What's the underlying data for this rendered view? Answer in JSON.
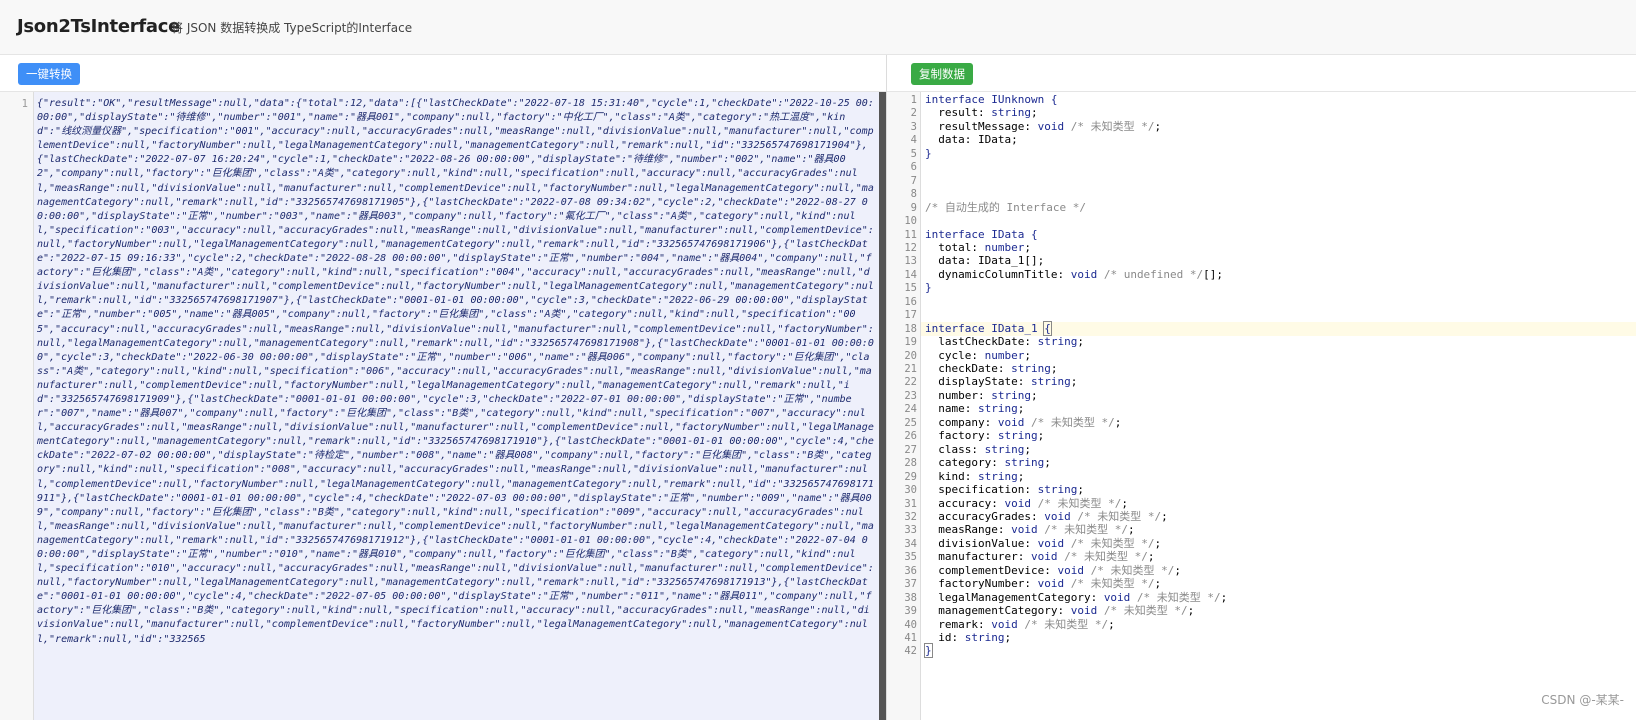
{
  "app": {
    "title": "Json2TsInterface",
    "subtitle": "将 JSON 数据转换成 TypeScript的Interface"
  },
  "toolbar": {
    "convert_label": "一键转换",
    "copy_label": "复制数据"
  },
  "left_editor": {
    "line_number": "1",
    "content": "{\"result\":\"OK\",\"resultMessage\":null,\"data\":{\"total\":12,\"data\":[{\"lastCheckDate\":\"2022-07-18 15:31:40\",\"cycle\":1,\"checkDate\":\"2022-10-25 00:00:00\",\"displayState\":\"待维修\",\"number\":\"001\",\"name\":\"器具001\",\"company\":null,\"factory\":\"中化工厂\",\"class\":\"A类\",\"category\":\"热工温度\",\"kind\":\"线纹测量仪器\",\"specification\":\"001\",\"accuracy\":null,\"accuracyGrades\":null,\"measRange\":null,\"divisionValue\":null,\"manufacturer\":null,\"complementDevice\":null,\"factoryNumber\":null,\"legalManagementCategory\":null,\"managementCategory\":null,\"remark\":null,\"id\":\"332565747698171904\"},{\"lastCheckDate\":\"2022-07-07 16:20:24\",\"cycle\":1,\"checkDate\":\"2022-08-26 00:00:00\",\"displayState\":\"待维修\",\"number\":\"002\",\"name\":\"器具002\",\"company\":null,\"factory\":\"巨化集团\",\"class\":\"A类\",\"category\":null,\"kind\":null,\"specification\":null,\"accuracy\":null,\"accuracyGrades\":null,\"measRange\":null,\"divisionValue\":null,\"manufacturer\":null,\"complementDevice\":null,\"factoryNumber\":null,\"legalManagementCategory\":null,\"managementCategory\":null,\"remark\":null,\"id\":\"332565747698171905\"},{\"lastCheckDate\":\"2022-07-08 09:34:02\",\"cycle\":2,\"checkDate\":\"2022-08-27 00:00:00\",\"displayState\":\"正常\",\"number\":\"003\",\"name\":\"器具003\",\"company\":null,\"factory\":\"氟化工厂\",\"class\":\"A类\",\"category\":null,\"kind\":null,\"specification\":\"003\",\"accuracy\":null,\"accuracyGrades\":null,\"measRange\":null,\"divisionValue\":null,\"manufacturer\":null,\"complementDevice\":null,\"factoryNumber\":null,\"legalManagementCategory\":null,\"managementCategory\":null,\"remark\":null,\"id\":\"332565747698171906\"},{\"lastCheckDate\":\"2022-07-15 09:16:33\",\"cycle\":2,\"checkDate\":\"2022-08-28 00:00:00\",\"displayState\":\"正常\",\"number\":\"004\",\"name\":\"器具004\",\"company\":null,\"factory\":\"巨化集团\",\"class\":\"A类\",\"category\":null,\"kind\":null,\"specification\":\"004\",\"accuracy\":null,\"accuracyGrades\":null,\"measRange\":null,\"divisionValue\":null,\"manufacturer\":null,\"complementDevice\":null,\"factoryNumber\":null,\"legalManagementCategory\":null,\"managementCategory\":null,\"remark\":null,\"id\":\"332565747698171907\"},{\"lastCheckDate\":\"0001-01-01 00:00:00\",\"cycle\":3,\"checkDate\":\"2022-06-29 00:00:00\",\"displayState\":\"正常\",\"number\":\"005\",\"name\":\"器具005\",\"company\":null,\"factory\":\"巨化集团\",\"class\":\"A类\",\"category\":null,\"kind\":null,\"specification\":\"005\",\"accuracy\":null,\"accuracyGrades\":null,\"measRange\":null,\"divisionValue\":null,\"manufacturer\":null,\"complementDevice\":null,\"factoryNumber\":null,\"legalManagementCategory\":null,\"managementCategory\":null,\"remark\":null,\"id\":\"332565747698171908\"},{\"lastCheckDate\":\"0001-01-01 00:00:00\",\"cycle\":3,\"checkDate\":\"2022-06-30 00:00:00\",\"displayState\":\"正常\",\"number\":\"006\",\"name\":\"器具006\",\"company\":null,\"factory\":\"巨化集团\",\"class\":\"A类\",\"category\":null,\"kind\":null,\"specification\":\"006\",\"accuracy\":null,\"accuracyGrades\":null,\"measRange\":null,\"divisionValue\":null,\"manufacturer\":null,\"complementDevice\":null,\"factoryNumber\":null,\"legalManagementCategory\":null,\"managementCategory\":null,\"remark\":null,\"id\":\"332565747698171909\"},{\"lastCheckDate\":\"0001-01-01 00:00:00\",\"cycle\":3,\"checkDate\":\"2022-07-01 00:00:00\",\"displayState\":\"正常\",\"number\":\"007\",\"name\":\"器具007\",\"company\":null,\"factory\":\"巨化集团\",\"class\":\"B类\",\"category\":null,\"kind\":null,\"specification\":\"007\",\"accuracy\":null,\"accuracyGrades\":null,\"measRange\":null,\"divisionValue\":null,\"manufacturer\":null,\"complementDevice\":null,\"factoryNumber\":null,\"legalManagementCategory\":null,\"managementCategory\":null,\"remark\":null,\"id\":\"332565747698171910\"},{\"lastCheckDate\":\"0001-01-01 00:00:00\",\"cycle\":4,\"checkDate\":\"2022-07-02 00:00:00\",\"displayState\":\"待检定\",\"number\":\"008\",\"name\":\"器具008\",\"company\":null,\"factory\":\"巨化集团\",\"class\":\"B类\",\"category\":null,\"kind\":null,\"specification\":\"008\",\"accuracy\":null,\"accuracyGrades\":null,\"measRange\":null,\"divisionValue\":null,\"manufacturer\":null,\"complementDevice\":null,\"factoryNumber\":null,\"legalManagementCategory\":null,\"managementCategory\":null,\"remark\":null,\"id\":\"332565747698171911\"},{\"lastCheckDate\":\"0001-01-01 00:00:00\",\"cycle\":4,\"checkDate\":\"2022-07-03 00:00:00\",\"displayState\":\"正常\",\"number\":\"009\",\"name\":\"器具009\",\"company\":null,\"factory\":\"巨化集团\",\"class\":\"B类\",\"category\":null,\"kind\":null,\"specification\":\"009\",\"accuracy\":null,\"accuracyGrades\":null,\"measRange\":null,\"divisionValue\":null,\"manufacturer\":null,\"complementDevice\":null,\"factoryNumber\":null,\"legalManagementCategory\":null,\"managementCategory\":null,\"remark\":null,\"id\":\"332565747698171912\"},{\"lastCheckDate\":\"0001-01-01 00:00:00\",\"cycle\":4,\"checkDate\":\"2022-07-04 00:00:00\",\"displayState\":\"正常\",\"number\":\"010\",\"name\":\"器具010\",\"company\":null,\"factory\":\"巨化集团\",\"class\":\"B类\",\"category\":null,\"kind\":null,\"specification\":\"010\",\"accuracy\":null,\"accuracyGrades\":null,\"measRange\":null,\"divisionValue\":null,\"manufacturer\":null,\"complementDevice\":null,\"factoryNumber\":null,\"legalManagementCategory\":null,\"managementCategory\":null,\"remark\":null,\"id\":\"332565747698171913\"},{\"lastCheckDate\":\"0001-01-01 00:00:00\",\"cycle\":4,\"checkDate\":\"2022-07-05 00:00:00\",\"displayState\":\"正常\",\"number\":\"011\",\"name\":\"器具011\",\"company\":null,\"factory\":\"巨化集团\",\"class\":\"B类\",\"category\":null,\"kind\":null,\"specification\":null,\"accuracy\":null,\"accuracyGrades\":null,\"measRange\":null,\"divisionValue\":null,\"manufacturer\":null,\"complementDevice\":null,\"factoryNumber\":null,\"legalManagementCategory\":null,\"managementCategory\":null,\"remark\":null,\"id\":\"332565"
  },
  "right_editor": {
    "lines": [
      {
        "n": "1",
        "parts": [
          [
            "kw",
            "interface IUnknown {"
          ]
        ]
      },
      {
        "n": "2",
        "parts": [
          [
            "t",
            "  result: "
          ],
          [
            "kw",
            "string"
          ],
          [
            "t",
            ";"
          ]
        ]
      },
      {
        "n": "3",
        "parts": [
          [
            "t",
            "  resultMessage: "
          ],
          [
            "kw",
            "void"
          ],
          [
            "cm",
            " /* 未知类型 */"
          ],
          [
            "t",
            ";"
          ]
        ]
      },
      {
        "n": "4",
        "parts": [
          [
            "t",
            "  data: IData;"
          ]
        ]
      },
      {
        "n": "5",
        "parts": [
          [
            "kw",
            "}"
          ]
        ]
      },
      {
        "n": "6",
        "parts": []
      },
      {
        "n": "7",
        "parts": []
      },
      {
        "n": "8",
        "parts": []
      },
      {
        "n": "9",
        "parts": [
          [
            "cm",
            "/* 自动生成的 Interface */"
          ]
        ]
      },
      {
        "n": "10",
        "parts": []
      },
      {
        "n": "11",
        "parts": [
          [
            "kw",
            "interface IData {"
          ]
        ]
      },
      {
        "n": "12",
        "parts": [
          [
            "t",
            "  total: "
          ],
          [
            "kw",
            "number"
          ],
          [
            "t",
            ";"
          ]
        ]
      },
      {
        "n": "13",
        "parts": [
          [
            "t",
            "  data: IData_1[];"
          ]
        ]
      },
      {
        "n": "14",
        "parts": [
          [
            "t",
            "  dynamicColumnTitle: "
          ],
          [
            "kw",
            "void"
          ],
          [
            "cm",
            " /* undefined */"
          ],
          [
            "t",
            "[];"
          ]
        ]
      },
      {
        "n": "15",
        "parts": [
          [
            "kw",
            "}"
          ]
        ]
      },
      {
        "n": "16",
        "parts": []
      },
      {
        "n": "17",
        "parts": []
      },
      {
        "n": "18",
        "parts": [
          [
            "kw",
            "interface IData_1 "
          ],
          [
            "cur",
            "{"
          ]
        ]
      },
      {
        "n": "19",
        "parts": [
          [
            "t",
            "  lastCheckDate: "
          ],
          [
            "kw",
            "string"
          ],
          [
            "t",
            ";"
          ]
        ]
      },
      {
        "n": "20",
        "parts": [
          [
            "t",
            "  cycle: "
          ],
          [
            "kw",
            "number"
          ],
          [
            "t",
            ";"
          ]
        ]
      },
      {
        "n": "21",
        "parts": [
          [
            "t",
            "  checkDate: "
          ],
          [
            "kw",
            "string"
          ],
          [
            "t",
            ";"
          ]
        ]
      },
      {
        "n": "22",
        "parts": [
          [
            "t",
            "  displayState: "
          ],
          [
            "kw",
            "string"
          ],
          [
            "t",
            ";"
          ]
        ]
      },
      {
        "n": "23",
        "parts": [
          [
            "t",
            "  number: "
          ],
          [
            "kw",
            "string"
          ],
          [
            "t",
            ";"
          ]
        ]
      },
      {
        "n": "24",
        "parts": [
          [
            "t",
            "  name: "
          ],
          [
            "kw",
            "string"
          ],
          [
            "t",
            ";"
          ]
        ]
      },
      {
        "n": "25",
        "parts": [
          [
            "t",
            "  company: "
          ],
          [
            "kw",
            "void"
          ],
          [
            "cm",
            " /* 未知类型 */"
          ],
          [
            "t",
            ";"
          ]
        ]
      },
      {
        "n": "26",
        "parts": [
          [
            "t",
            "  factory: "
          ],
          [
            "kw",
            "string"
          ],
          [
            "t",
            ";"
          ]
        ]
      },
      {
        "n": "27",
        "parts": [
          [
            "t",
            "  class: "
          ],
          [
            "kw",
            "string"
          ],
          [
            "t",
            ";"
          ]
        ]
      },
      {
        "n": "28",
        "parts": [
          [
            "t",
            "  category: "
          ],
          [
            "kw",
            "string"
          ],
          [
            "t",
            ";"
          ]
        ]
      },
      {
        "n": "29",
        "parts": [
          [
            "t",
            "  kind: "
          ],
          [
            "kw",
            "string"
          ],
          [
            "t",
            ";"
          ]
        ]
      },
      {
        "n": "30",
        "parts": [
          [
            "t",
            "  specification: "
          ],
          [
            "kw",
            "string"
          ],
          [
            "t",
            ";"
          ]
        ]
      },
      {
        "n": "31",
        "parts": [
          [
            "t",
            "  accuracy: "
          ],
          [
            "kw",
            "void"
          ],
          [
            "cm",
            " /* 未知类型 */"
          ],
          [
            "t",
            ";"
          ]
        ]
      },
      {
        "n": "32",
        "parts": [
          [
            "t",
            "  accuracyGrades: "
          ],
          [
            "kw",
            "void"
          ],
          [
            "cm",
            " /* 未知类型 */"
          ],
          [
            "t",
            ";"
          ]
        ]
      },
      {
        "n": "33",
        "parts": [
          [
            "t",
            "  measRange: "
          ],
          [
            "kw",
            "void"
          ],
          [
            "cm",
            " /* 未知类型 */"
          ],
          [
            "t",
            ";"
          ]
        ]
      },
      {
        "n": "34",
        "parts": [
          [
            "t",
            "  divisionValue: "
          ],
          [
            "kw",
            "void"
          ],
          [
            "cm",
            " /* 未知类型 */"
          ],
          [
            "t",
            ";"
          ]
        ]
      },
      {
        "n": "35",
        "parts": [
          [
            "t",
            "  manufacturer: "
          ],
          [
            "kw",
            "void"
          ],
          [
            "cm",
            " /* 未知类型 */"
          ],
          [
            "t",
            ";"
          ]
        ]
      },
      {
        "n": "36",
        "parts": [
          [
            "t",
            "  complementDevice: "
          ],
          [
            "kw",
            "void"
          ],
          [
            "cm",
            " /* 未知类型 */"
          ],
          [
            "t",
            ";"
          ]
        ]
      },
      {
        "n": "37",
        "parts": [
          [
            "t",
            "  factoryNumber: "
          ],
          [
            "kw",
            "void"
          ],
          [
            "cm",
            " /* 未知类型 */"
          ],
          [
            "t",
            ";"
          ]
        ]
      },
      {
        "n": "38",
        "parts": [
          [
            "t",
            "  legalManagementCategory: "
          ],
          [
            "kw",
            "void"
          ],
          [
            "cm",
            " /* 未知类型 */"
          ],
          [
            "t",
            ";"
          ]
        ]
      },
      {
        "n": "39",
        "parts": [
          [
            "t",
            "  managementCategory: "
          ],
          [
            "kw",
            "void"
          ],
          [
            "cm",
            " /* 未知类型 */"
          ],
          [
            "t",
            ";"
          ]
        ]
      },
      {
        "n": "40",
        "parts": [
          [
            "t",
            "  remark: "
          ],
          [
            "kw",
            "void"
          ],
          [
            "cm",
            " /* 未知类型 */"
          ],
          [
            "t",
            ";"
          ]
        ]
      },
      {
        "n": "41",
        "parts": [
          [
            "t",
            "  id: "
          ],
          [
            "kw",
            "string"
          ],
          [
            "t",
            ";"
          ]
        ]
      },
      {
        "n": "42",
        "parts": [
          [
            "cur",
            "}"
          ]
        ]
      }
    ],
    "highlighted_line": "18"
  },
  "watermark": "CSDN @-某某-",
  "colors": {
    "convert_button": "#3f8ff7",
    "copy_button": "#3aaa45",
    "keyword": "#1c2a91",
    "comment": "#8a8a8a",
    "json_text": "#1d2a6e",
    "left_editor_bg": "#eef0fb"
  }
}
